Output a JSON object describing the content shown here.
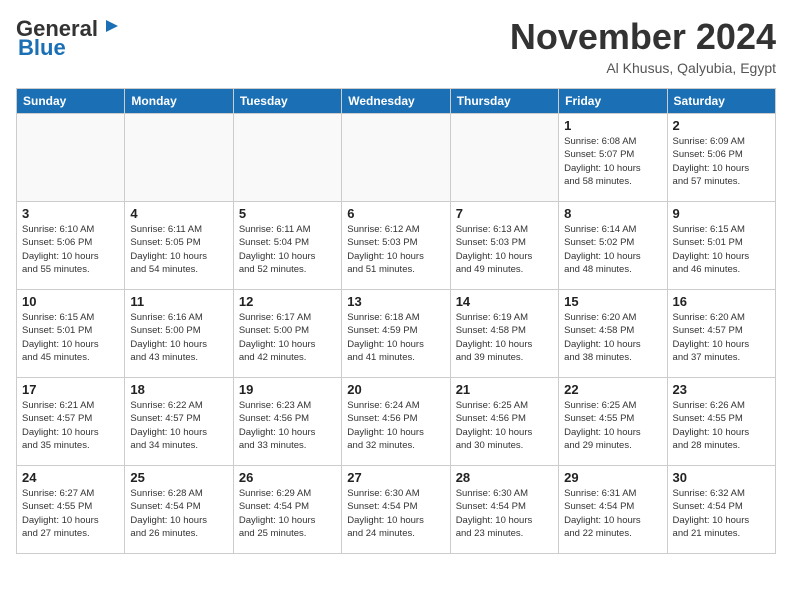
{
  "header": {
    "logo_general": "General",
    "logo_blue": "Blue",
    "month": "November 2024",
    "location": "Al Khusus, Qalyubia, Egypt"
  },
  "weekdays": [
    "Sunday",
    "Monday",
    "Tuesday",
    "Wednesday",
    "Thursday",
    "Friday",
    "Saturday"
  ],
  "weeks": [
    [
      {
        "day": "",
        "info": ""
      },
      {
        "day": "",
        "info": ""
      },
      {
        "day": "",
        "info": ""
      },
      {
        "day": "",
        "info": ""
      },
      {
        "day": "",
        "info": ""
      },
      {
        "day": "1",
        "info": "Sunrise: 6:08 AM\nSunset: 5:07 PM\nDaylight: 10 hours\nand 58 minutes."
      },
      {
        "day": "2",
        "info": "Sunrise: 6:09 AM\nSunset: 5:06 PM\nDaylight: 10 hours\nand 57 minutes."
      }
    ],
    [
      {
        "day": "3",
        "info": "Sunrise: 6:10 AM\nSunset: 5:06 PM\nDaylight: 10 hours\nand 55 minutes."
      },
      {
        "day": "4",
        "info": "Sunrise: 6:11 AM\nSunset: 5:05 PM\nDaylight: 10 hours\nand 54 minutes."
      },
      {
        "day": "5",
        "info": "Sunrise: 6:11 AM\nSunset: 5:04 PM\nDaylight: 10 hours\nand 52 minutes."
      },
      {
        "day": "6",
        "info": "Sunrise: 6:12 AM\nSunset: 5:03 PM\nDaylight: 10 hours\nand 51 minutes."
      },
      {
        "day": "7",
        "info": "Sunrise: 6:13 AM\nSunset: 5:03 PM\nDaylight: 10 hours\nand 49 minutes."
      },
      {
        "day": "8",
        "info": "Sunrise: 6:14 AM\nSunset: 5:02 PM\nDaylight: 10 hours\nand 48 minutes."
      },
      {
        "day": "9",
        "info": "Sunrise: 6:15 AM\nSunset: 5:01 PM\nDaylight: 10 hours\nand 46 minutes."
      }
    ],
    [
      {
        "day": "10",
        "info": "Sunrise: 6:15 AM\nSunset: 5:01 PM\nDaylight: 10 hours\nand 45 minutes."
      },
      {
        "day": "11",
        "info": "Sunrise: 6:16 AM\nSunset: 5:00 PM\nDaylight: 10 hours\nand 43 minutes."
      },
      {
        "day": "12",
        "info": "Sunrise: 6:17 AM\nSunset: 5:00 PM\nDaylight: 10 hours\nand 42 minutes."
      },
      {
        "day": "13",
        "info": "Sunrise: 6:18 AM\nSunset: 4:59 PM\nDaylight: 10 hours\nand 41 minutes."
      },
      {
        "day": "14",
        "info": "Sunrise: 6:19 AM\nSunset: 4:58 PM\nDaylight: 10 hours\nand 39 minutes."
      },
      {
        "day": "15",
        "info": "Sunrise: 6:20 AM\nSunset: 4:58 PM\nDaylight: 10 hours\nand 38 minutes."
      },
      {
        "day": "16",
        "info": "Sunrise: 6:20 AM\nSunset: 4:57 PM\nDaylight: 10 hours\nand 37 minutes."
      }
    ],
    [
      {
        "day": "17",
        "info": "Sunrise: 6:21 AM\nSunset: 4:57 PM\nDaylight: 10 hours\nand 35 minutes."
      },
      {
        "day": "18",
        "info": "Sunrise: 6:22 AM\nSunset: 4:57 PM\nDaylight: 10 hours\nand 34 minutes."
      },
      {
        "day": "19",
        "info": "Sunrise: 6:23 AM\nSunset: 4:56 PM\nDaylight: 10 hours\nand 33 minutes."
      },
      {
        "day": "20",
        "info": "Sunrise: 6:24 AM\nSunset: 4:56 PM\nDaylight: 10 hours\nand 32 minutes."
      },
      {
        "day": "21",
        "info": "Sunrise: 6:25 AM\nSunset: 4:56 PM\nDaylight: 10 hours\nand 30 minutes."
      },
      {
        "day": "22",
        "info": "Sunrise: 6:25 AM\nSunset: 4:55 PM\nDaylight: 10 hours\nand 29 minutes."
      },
      {
        "day": "23",
        "info": "Sunrise: 6:26 AM\nSunset: 4:55 PM\nDaylight: 10 hours\nand 28 minutes."
      }
    ],
    [
      {
        "day": "24",
        "info": "Sunrise: 6:27 AM\nSunset: 4:55 PM\nDaylight: 10 hours\nand 27 minutes."
      },
      {
        "day": "25",
        "info": "Sunrise: 6:28 AM\nSunset: 4:54 PM\nDaylight: 10 hours\nand 26 minutes."
      },
      {
        "day": "26",
        "info": "Sunrise: 6:29 AM\nSunset: 4:54 PM\nDaylight: 10 hours\nand 25 minutes."
      },
      {
        "day": "27",
        "info": "Sunrise: 6:30 AM\nSunset: 4:54 PM\nDaylight: 10 hours\nand 24 minutes."
      },
      {
        "day": "28",
        "info": "Sunrise: 6:30 AM\nSunset: 4:54 PM\nDaylight: 10 hours\nand 23 minutes."
      },
      {
        "day": "29",
        "info": "Sunrise: 6:31 AM\nSunset: 4:54 PM\nDaylight: 10 hours\nand 22 minutes."
      },
      {
        "day": "30",
        "info": "Sunrise: 6:32 AM\nSunset: 4:54 PM\nDaylight: 10 hours\nand 21 minutes."
      }
    ]
  ]
}
